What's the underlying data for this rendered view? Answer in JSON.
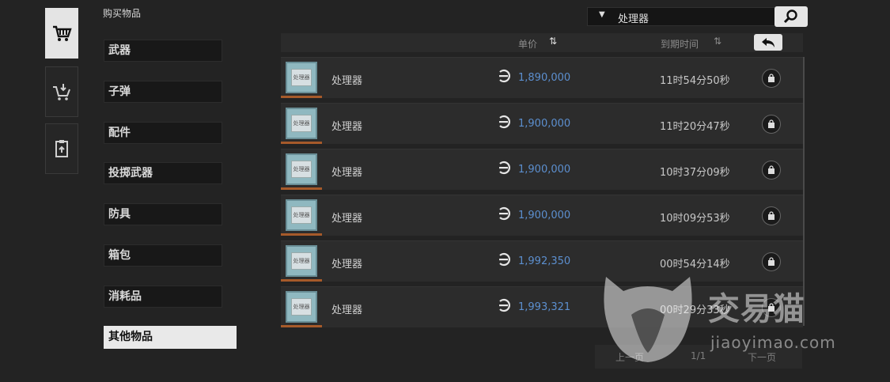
{
  "section_title": "购买物品",
  "tabs": [
    {
      "icon": "cart-icon"
    },
    {
      "icon": "cart-sell-icon"
    },
    {
      "icon": "clipboard-upload-icon"
    }
  ],
  "categories": [
    "武器",
    "子弹",
    "配件",
    "投掷武器",
    "防具",
    "箱包",
    "消耗品",
    "其他物品"
  ],
  "active_category": "其他物品",
  "search": {
    "value": "处理器"
  },
  "header": {
    "price_label": "单价",
    "expire_label": "到期时间"
  },
  "rows": [
    {
      "name": "处理器",
      "thumb_text": "处理器",
      "price": "1,890,000",
      "time": "11时54分50秒"
    },
    {
      "name": "处理器",
      "thumb_text": "处理器",
      "price": "1,900,000",
      "time": "11时20分47秒"
    },
    {
      "name": "处理器",
      "thumb_text": "处理器",
      "price": "1,900,000",
      "time": "10时37分09秒"
    },
    {
      "name": "处理器",
      "thumb_text": "处理器",
      "price": "1,900,000",
      "time": "10时09分53秒"
    },
    {
      "name": "处理器",
      "thumb_text": "处理器",
      "price": "1,992,350",
      "time": "00时54分14秒"
    },
    {
      "name": "处理器",
      "thumb_text": "处理器",
      "price": "1,993,321",
      "time": "00时29分33秒"
    }
  ],
  "pagination": {
    "prev": "上一页",
    "page": "1/1",
    "next": "下一页"
  },
  "watermark": {
    "brand": "交易猫",
    "site": "jiaoyimao.com"
  },
  "colors": {
    "background": "#232323",
    "price": "#5c8fcf",
    "active": "#e9e9e9"
  }
}
